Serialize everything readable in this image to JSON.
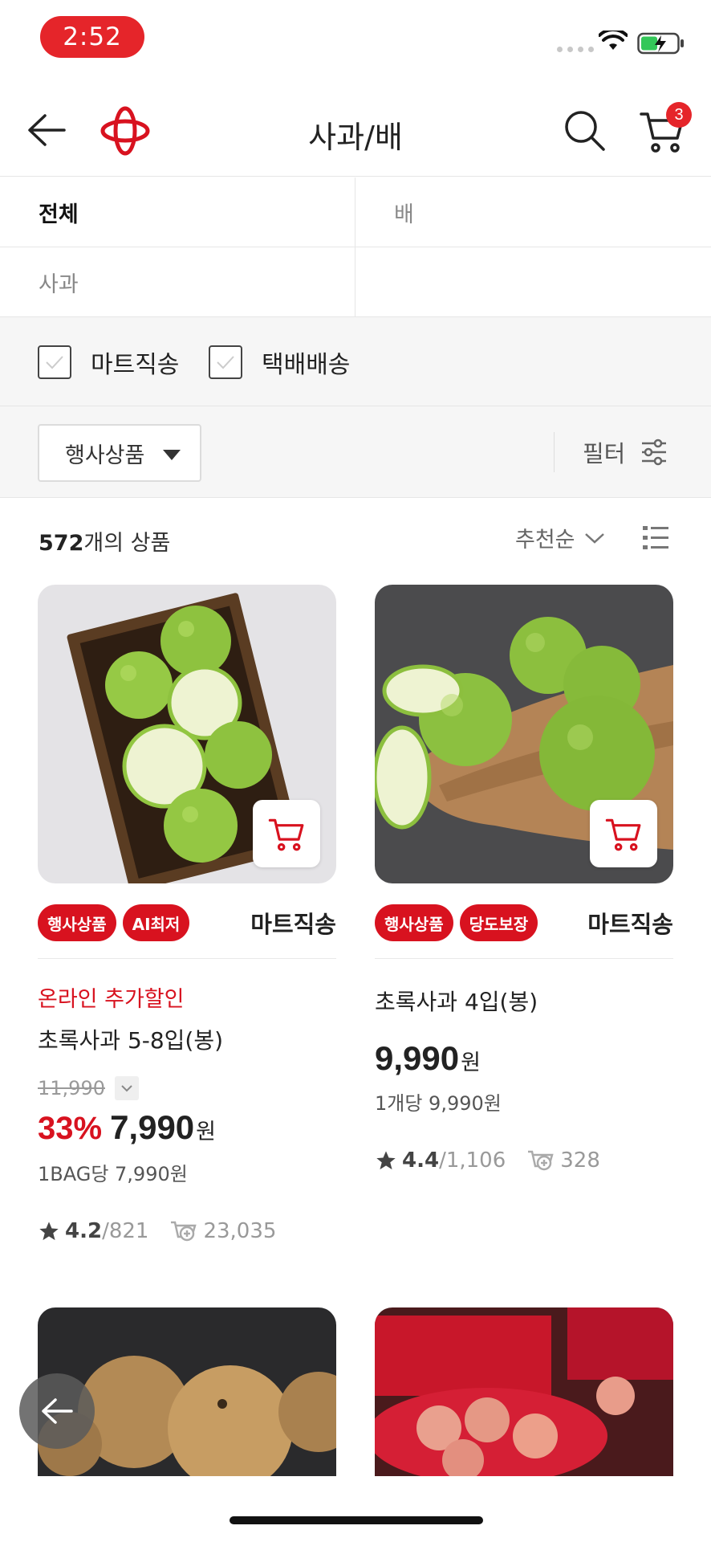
{
  "status_bar": {
    "time": "2:52"
  },
  "header": {
    "title": "사과/배",
    "cart_count": "3"
  },
  "categories": [
    {
      "label": "전체",
      "active": true
    },
    {
      "label": "배",
      "active": false
    },
    {
      "label": "사과",
      "active": false
    }
  ],
  "delivery_options": [
    "마트직송",
    "택배배송"
  ],
  "filter_bar": {
    "event_select": "행사상품",
    "filter_label": "필터"
  },
  "list_header": {
    "count_number": "572",
    "count_suffix": "개의 상품",
    "sort_label": "추천순"
  },
  "products": [
    {
      "tags": [
        "행사상품",
        "AI최저"
      ],
      "shipping": "마트직송",
      "promo": "온라인 추가할인",
      "name": "초록사과 5-8입(봉)",
      "original_price": "11,990",
      "discount": "33%",
      "price": "7,990",
      "currency": "원",
      "unit_price": "1BAG당 7,990원",
      "rating": "4.2",
      "review_count": "/821",
      "cart_adds": "23,035"
    },
    {
      "tags": [
        "행사상품",
        "당도보장"
      ],
      "shipping": "마트직송",
      "name": "초록사과 4입(봉)",
      "price": "9,990",
      "currency": "원",
      "unit_price": "1개당 9,990원",
      "rating": "4.4",
      "review_count": "/1,106",
      "cart_adds": "328"
    }
  ],
  "colors": {
    "brand_red": "#d8121f",
    "status_pill": "#e5252a"
  }
}
